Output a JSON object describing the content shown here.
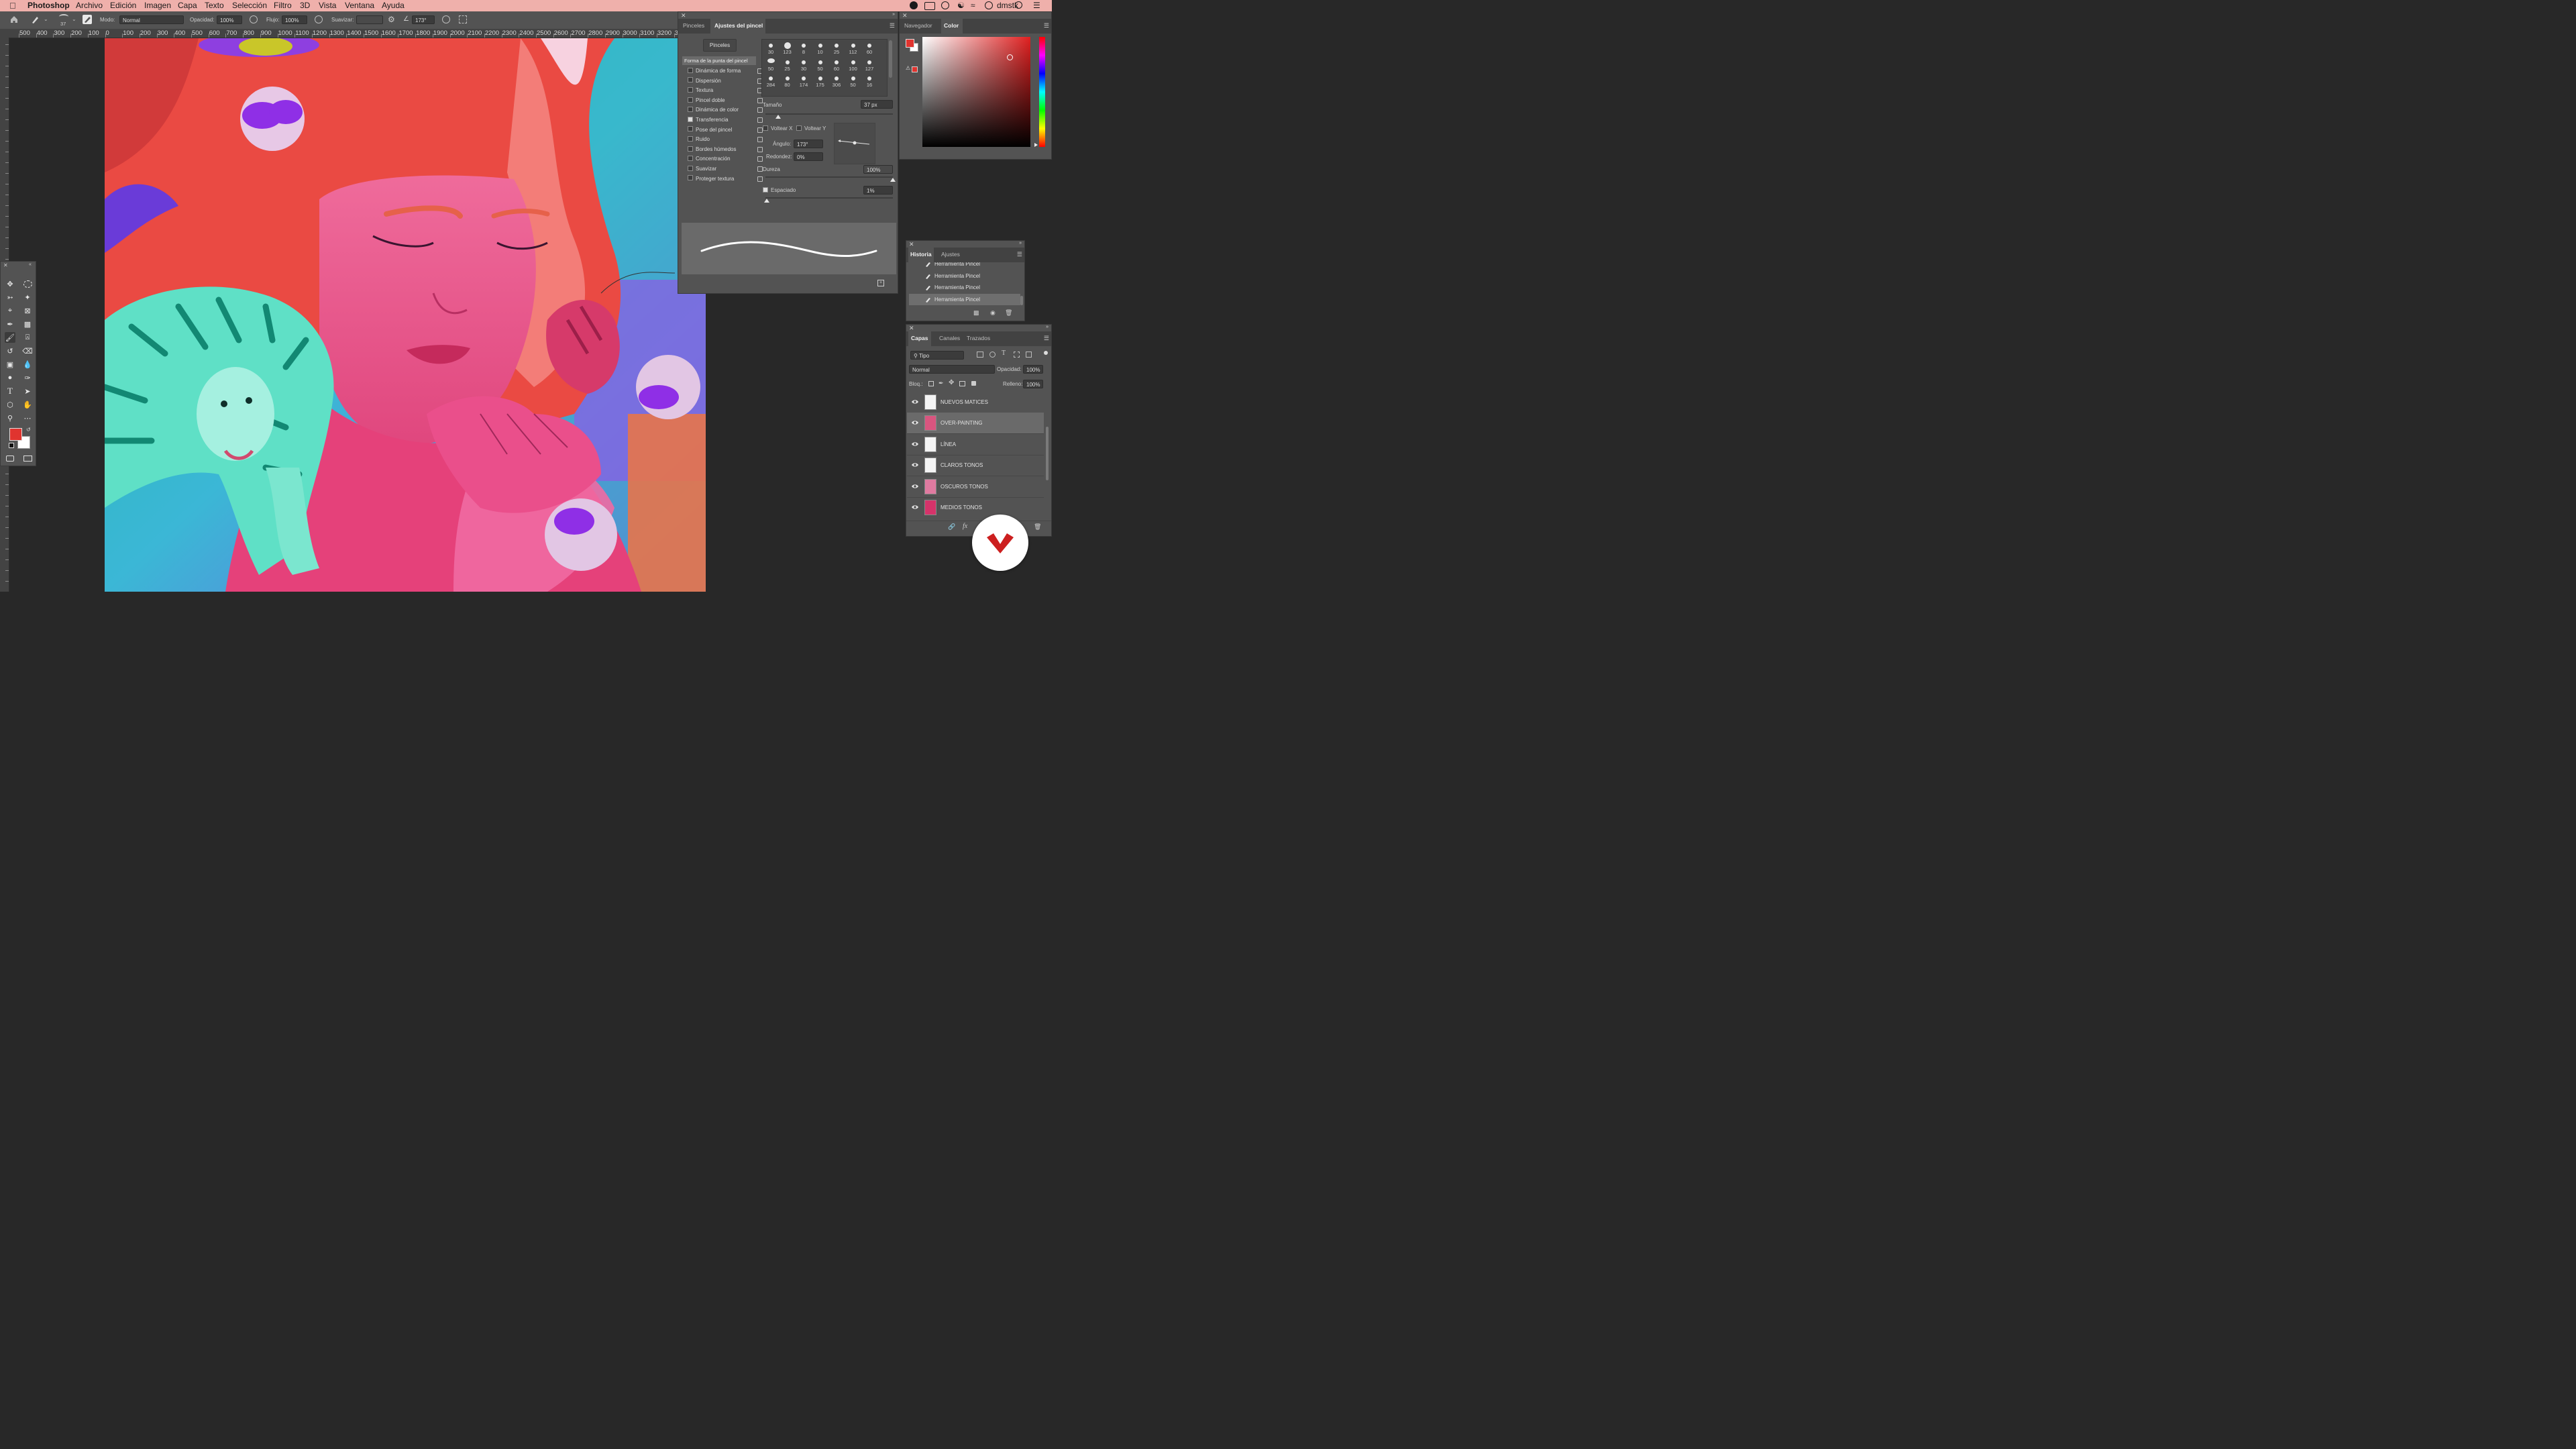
{
  "menubar": {
    "app": "Photoshop",
    "items": [
      "Archivo",
      "Edición",
      "Imagen",
      "Capa",
      "Texto",
      "Selección",
      "Filtro",
      "3D",
      "Vista",
      "Ventana",
      "Ayuda"
    ],
    "user": "dmstk"
  },
  "options": {
    "brush_size": "37",
    "mode_label": "Modo:",
    "mode_value": "Normal",
    "opacity_label": "Opacidad:",
    "opacity_value": "100%",
    "flow_label": "Flujo:",
    "flow_value": "100%",
    "smooth_label": "Suavizar:",
    "smooth_value": "",
    "angle_value": "173°"
  },
  "ruler_top": [
    "500",
    "400",
    "300",
    "200",
    "100",
    "0",
    "100",
    "200",
    "300",
    "400",
    "500",
    "600",
    "700",
    "800",
    "900",
    "1000",
    "1100",
    "1200",
    "1300",
    "1400",
    "1500",
    "1600",
    "1700",
    "1800",
    "1900",
    "2000",
    "2100",
    "2200",
    "2300",
    "2400",
    "2500",
    "2600",
    "2700",
    "2800",
    "2900",
    "3000",
    "3100",
    "3200",
    "33"
  ],
  "brush_panel": {
    "tabs": [
      "Pinceles",
      "Ajustes del pincel"
    ],
    "active_tab": "Ajustes del pincel",
    "brushes_button": "Pinceles",
    "tip_shape": "Forma de la punta del pincel",
    "options": [
      {
        "label": "Dinámica de forma",
        "checked": false
      },
      {
        "label": "Dispersión",
        "checked": false
      },
      {
        "label": "Textura",
        "checked": false
      },
      {
        "label": "Pincel doble",
        "checked": false
      },
      {
        "label": "Dinámica de color",
        "checked": false
      },
      {
        "label": "Transferencia",
        "checked": true
      },
      {
        "label": "Pose del pincel",
        "checked": false
      },
      {
        "label": "Ruido",
        "checked": false
      },
      {
        "label": "Bordes húmedos",
        "checked": false
      },
      {
        "label": "Concentración",
        "checked": false
      },
      {
        "label": "Suavizar",
        "checked": false
      },
      {
        "label": "Proteger textura",
        "checked": false
      }
    ],
    "brush_sizes_row1": [
      "30",
      "123",
      "8",
      "10",
      "25",
      "112",
      "60"
    ],
    "brush_sizes_row2": [
      "50",
      "25",
      "30",
      "50",
      "60",
      "100",
      "127"
    ],
    "brush_sizes_row3": [
      "284",
      "80",
      "174",
      "175",
      "306",
      "50",
      "16"
    ],
    "size_label": "Tamaño",
    "size_value": "37 px",
    "size_fraction": 0.1,
    "flip_x": "Voltear X",
    "flip_y": "Voltear Y",
    "angle_label": "Ángulo:",
    "angle_value": "173°",
    "roundness_label": "Redondez:",
    "roundness_value": "0%",
    "hardness_label": "Dureza",
    "hardness_value": "100%",
    "hardness_fraction": 1.0,
    "spacing_label": "Espaciado",
    "spacing_value": "1%",
    "spacing_fraction": 0.01
  },
  "nav_panel": {
    "tabs": [
      "Navegador",
      "Color"
    ],
    "active_tab": "Color",
    "fg_color": "#e0342f",
    "bg_color": "#ffffff"
  },
  "history_panel": {
    "tabs": [
      "Historia",
      "Ajustes"
    ],
    "active_tab": "Historia",
    "items": [
      "Herramienta Pincel",
      "Herramienta Pincel",
      "Herramienta Pincel",
      "Herramienta Pincel"
    ]
  },
  "layers_panel": {
    "tabs": [
      "Capas",
      "Canales",
      "Trazados"
    ],
    "active_tab": "Capas",
    "filter": "Tipo",
    "blend_mode": "Normal",
    "opacity_label": "Opacidad:",
    "opacity_value": "100%",
    "lock_label": "Bloq.:",
    "fill_label": "Relleno:",
    "fill_value": "100%",
    "layers": [
      {
        "name": "NUEVOS MATICES",
        "selected": false
      },
      {
        "name": "OVER-PAINTING",
        "selected": true
      },
      {
        "name": "LÍNEA",
        "selected": false
      },
      {
        "name": "CLAROS TONOS",
        "selected": false
      },
      {
        "name": "OSCUROS TONOS",
        "selected": false
      },
      {
        "name": "MEDIOS TONOS",
        "selected": false
      }
    ]
  },
  "colors": {
    "foreground": "#e0342f",
    "background": "#ffffff",
    "panel": "#535353",
    "watermark": "#cc1f1f"
  }
}
